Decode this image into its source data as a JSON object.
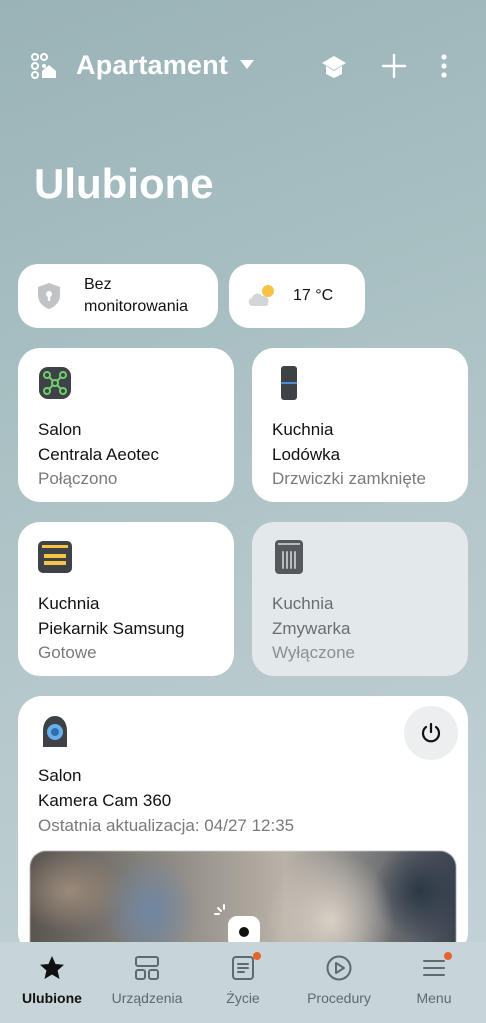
{
  "header": {
    "home_name": "Apartament"
  },
  "page_title": "Ulubione",
  "chips": {
    "security": "Bez monitorowania",
    "weather": "17 °C"
  },
  "devices": [
    {
      "room": "Salon",
      "name": "Centrala Aeotec",
      "status": "Połączono",
      "icon": "hub-icon",
      "state": "on"
    },
    {
      "room": "Kuchnia",
      "name": "Lodówka",
      "status": "Drzwiczki zamknięte",
      "icon": "fridge-icon",
      "state": "on"
    },
    {
      "room": "Kuchnia",
      "name": "Piekarnik Samsung",
      "status": "Gotowe",
      "icon": "oven-icon",
      "state": "on"
    },
    {
      "room": "Kuchnia",
      "name": "Zmywarka",
      "status": "Wyłączone",
      "icon": "dishwasher-icon",
      "state": "off"
    }
  ],
  "camera": {
    "room": "Salon",
    "name": "Kamera Cam 360",
    "status": "Ostatnia aktualizacja: 04/27 12:35",
    "icon": "camera-icon"
  },
  "nav": [
    {
      "label": "Ulubione",
      "icon": "star-icon",
      "active": true,
      "badge": false
    },
    {
      "label": "Urządzenia",
      "icon": "devices-grid-icon",
      "active": false,
      "badge": false
    },
    {
      "label": "Życie",
      "icon": "life-icon",
      "active": false,
      "badge": true
    },
    {
      "label": "Procedury",
      "icon": "play-circle-icon",
      "active": false,
      "badge": false
    },
    {
      "label": "Menu",
      "icon": "hamburger-menu-icon",
      "active": false,
      "badge": true
    }
  ],
  "colors": {
    "badge": "#e8622a",
    "accent_blue": "#4a8fd6",
    "oven_yellow": "#f6c445"
  }
}
